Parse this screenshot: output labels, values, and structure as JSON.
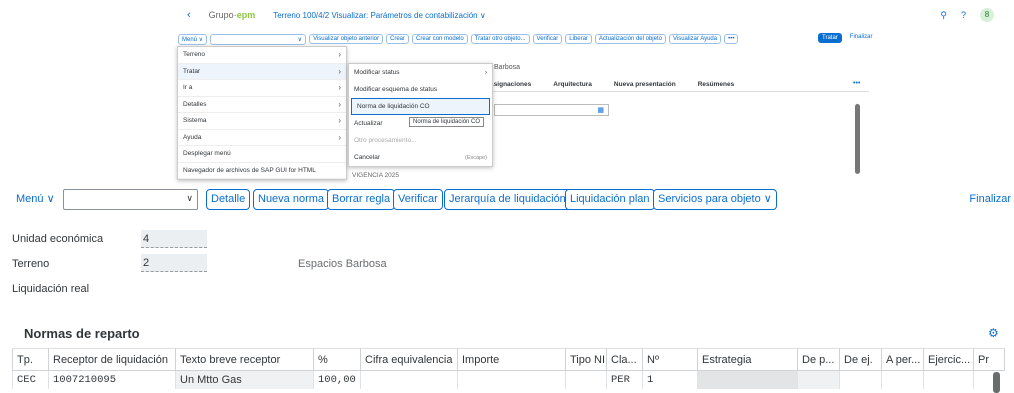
{
  "inset": {
    "back": "‹",
    "logo_prefix": "Grupo·",
    "logo_brand": "epm",
    "title": "Terreno 100/4/2 Visualizar: Parámetros de contabilización",
    "title_chevron": "∨",
    "header_icons": {
      "search": "⚲",
      "help": "?",
      "avatar": "8"
    },
    "toolbar": {
      "menu": "Menú ∨",
      "select_arrow": "∨",
      "buttons": [
        "Visualizar objeto anterior",
        "Crear",
        "Crear con modelo",
        "Tratar otro objeto...",
        "Verificar",
        "Liberar",
        "Actualización del objeto",
        "Visualizar Ayuda",
        "•••"
      ],
      "primary": "Tratar",
      "finish": "Finalizar"
    },
    "barbosa": "Barbosa",
    "table_headers": [
      "Asignaciones",
      "Arquitectura",
      "Nueva presentación",
      "Resúmenes"
    ],
    "dots": "•••",
    "vigencia": "VIGENCIA 2025",
    "menu_main": [
      "Terreno",
      "Tratar",
      "Ir a",
      "Detalles",
      "Sistema",
      "Ayuda",
      "Desplegar menú",
      "Navegador de archivos de SAP GUI for HTML"
    ],
    "menu_sub": [
      {
        "label": "Modificar status",
        "shortcut": ""
      },
      {
        "label": "Modificar esquema de status",
        "shortcut": ""
      },
      {
        "label": "Norma de liquidación CO",
        "shortcut": ""
      },
      {
        "label": "Actualizar",
        "shortcut": ""
      },
      {
        "label": "Otro procesamiento...",
        "shortcut": ""
      },
      {
        "label": "Cancelar",
        "shortcut": "(Escape)"
      }
    ],
    "tooltip": "Norma de liquidación CO"
  },
  "toolbar": {
    "menu": "Menú ∨",
    "combo_arrow": "∨",
    "buttons": [
      "Detalle",
      "Nueva norma",
      "Borrar regla",
      "Verificar",
      "Jerarquía de liquidación",
      "Liquidación plan",
      "Servicios para objeto ∨"
    ],
    "finish": "Finalizar"
  },
  "form": {
    "unidad_label": "Unidad económica",
    "unidad_value": "4",
    "terreno_label": "Terreno",
    "terreno_value": "2",
    "terreno_desc": "Espacios Barbosa",
    "liquidacion_label": "Liquidación real"
  },
  "section_title": "Normas de reparto",
  "table": {
    "headers": [
      "Tp.",
      "Receptor de liquidación",
      "Texto breve receptor",
      "%",
      "Cifra equivalencia",
      "Importe",
      "Tipo NI",
      "Cla...",
      "Nº",
      "Estrategia",
      "De p...",
      "De ej.",
      "A per...",
      "Ejercic...",
      "Pr"
    ],
    "row": [
      "CEC",
      "1007210095",
      "Un Mtto Gas",
      "100,00",
      "",
      "",
      "",
      "PER",
      "1",
      "",
      "",
      "",
      "",
      "",
      ""
    ]
  }
}
